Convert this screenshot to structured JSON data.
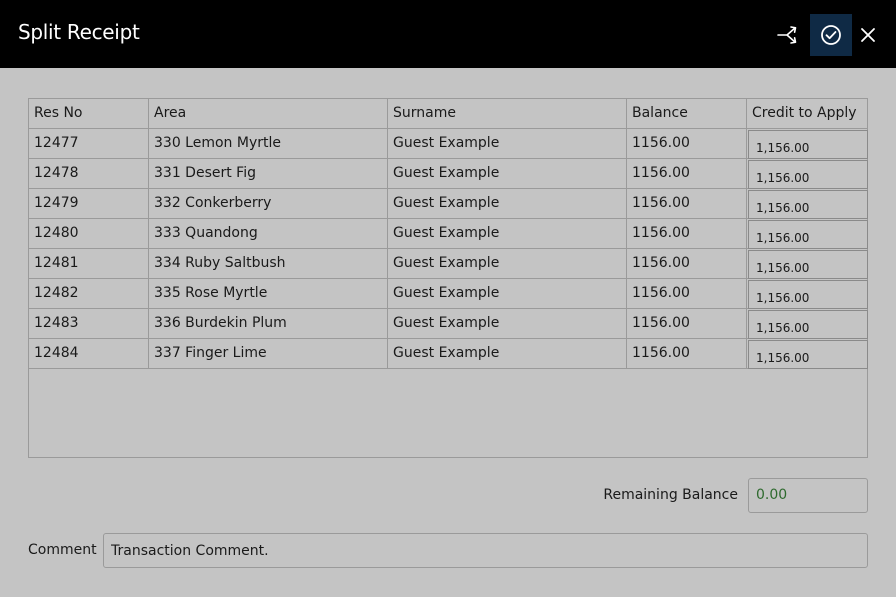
{
  "window": {
    "title": "Split Receipt",
    "buttons": {
      "split": "split-icon",
      "confirm": "check-circle-icon",
      "close": "close-icon"
    }
  },
  "colors": {
    "titlebar": "#000000",
    "confirm_button_bg": "#0f2a45",
    "background": "#c4c4c4",
    "remaining_value": "#2e6a2e"
  },
  "table": {
    "columns": [
      "Res No",
      "Area",
      "Surname",
      "Balance",
      "Credit to Apply"
    ],
    "rows": [
      {
        "res_no": "12477",
        "area": "330 Lemon Myrtle",
        "surname": "Guest Example",
        "balance": "1156.00",
        "credit": "1,156.00"
      },
      {
        "res_no": "12478",
        "area": "331 Desert Fig",
        "surname": "Guest Example",
        "balance": "1156.00",
        "credit": "1,156.00"
      },
      {
        "res_no": "12479",
        "area": "332 Conkerberry",
        "surname": "Guest Example",
        "balance": "1156.00",
        "credit": "1,156.00"
      },
      {
        "res_no": "12480",
        "area": "333 Quandong",
        "surname": "Guest Example",
        "balance": "1156.00",
        "credit": "1,156.00"
      },
      {
        "res_no": "12481",
        "area": "334 Ruby Saltbush",
        "surname": "Guest Example",
        "balance": "1156.00",
        "credit": "1,156.00"
      },
      {
        "res_no": "12482",
        "area": "335 Rose Myrtle",
        "surname": "Guest Example",
        "balance": "1156.00",
        "credit": "1,156.00"
      },
      {
        "res_no": "12483",
        "area": "336 Burdekin Plum",
        "surname": "Guest Example",
        "balance": "1156.00",
        "credit": "1,156.00"
      },
      {
        "res_no": "12484",
        "area": "337 Finger Lime",
        "surname": "Guest Example",
        "balance": "1156.00",
        "credit": "1,156.00"
      }
    ]
  },
  "remaining_balance": {
    "label": "Remaining Balance",
    "value": "0.00"
  },
  "comment": {
    "label": "Comment",
    "value": "Transaction Comment."
  }
}
